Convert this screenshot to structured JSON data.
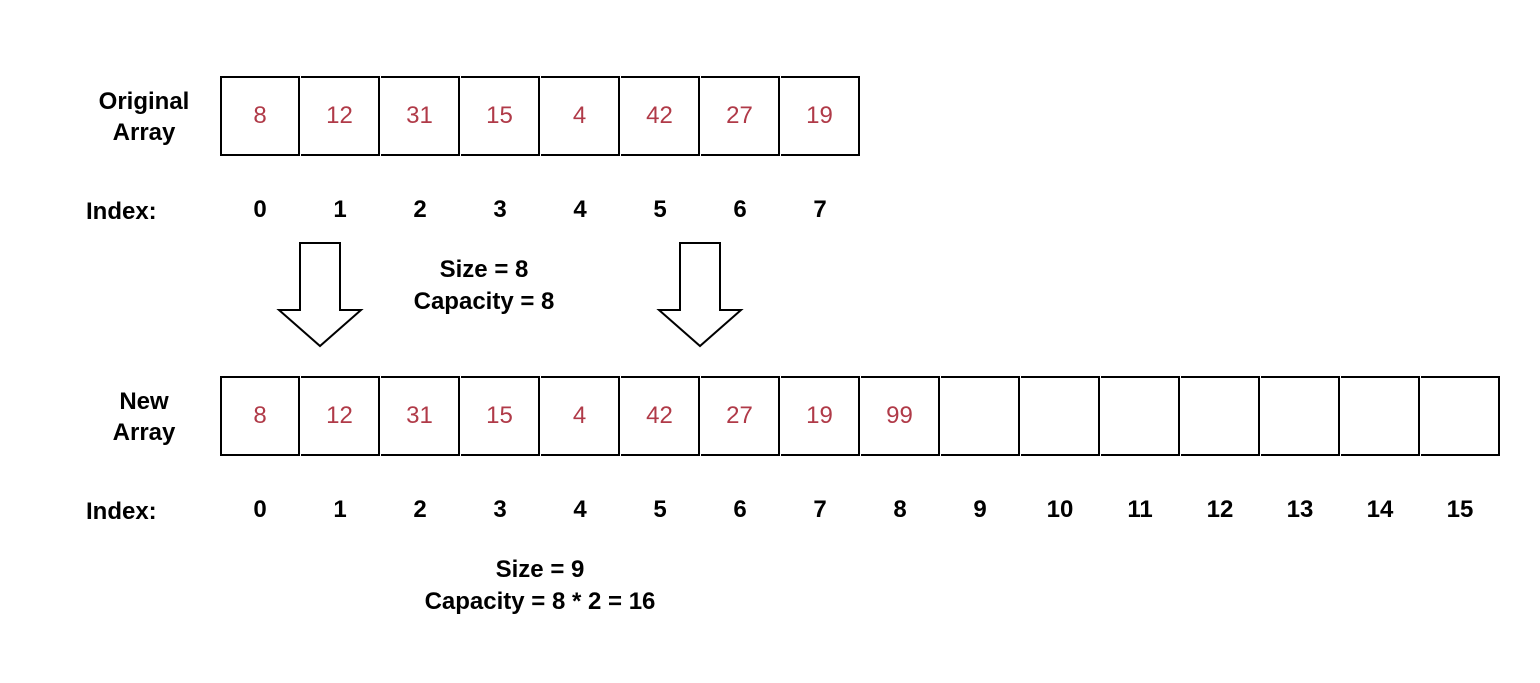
{
  "original": {
    "label_line1": "Original",
    "label_line2": "Array",
    "index_label": "Index:",
    "values": [
      "8",
      "12",
      "31",
      "15",
      "4",
      "42",
      "27",
      "19"
    ],
    "indices": [
      "0",
      "1",
      "2",
      "3",
      "4",
      "5",
      "6",
      "7"
    ],
    "size_text": "Size = 8",
    "capacity_text": "Capacity = 8"
  },
  "new_array": {
    "label_line1": "New",
    "label_line2": "Array",
    "index_label": "Index:",
    "values": [
      "8",
      "12",
      "31",
      "15",
      "4",
      "42",
      "27",
      "19",
      "99",
      "",
      "",
      "",
      "",
      "",
      "",
      ""
    ],
    "indices": [
      "0",
      "1",
      "2",
      "3",
      "4",
      "5",
      "6",
      "7",
      "8",
      "9",
      "10",
      "11",
      "12",
      "13",
      "14",
      "15"
    ],
    "size_text": "Size = 9",
    "capacity_text": "Capacity = 8 * 2 = 16"
  },
  "arrows": [
    {
      "icon": "down-arrow-icon"
    },
    {
      "icon": "down-arrow-icon"
    }
  ],
  "colors": {
    "value_text": "#b03a48",
    "border": "#000000"
  }
}
